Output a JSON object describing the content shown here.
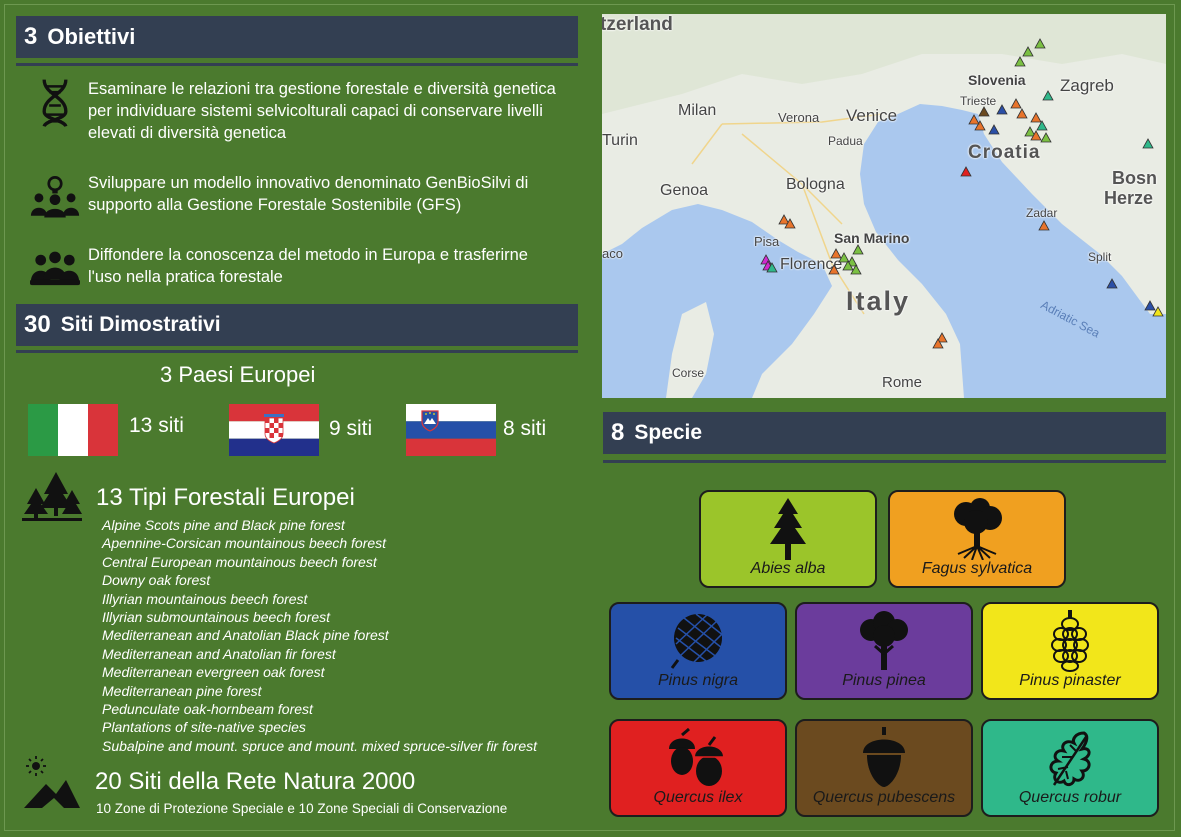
{
  "sections": {
    "objectives": {
      "number": "3",
      "title": "Obiettivi"
    },
    "sites": {
      "number": "30",
      "title": "Siti Dimostrativi"
    },
    "species": {
      "number": "8",
      "title": "Specie"
    }
  },
  "objectives": [
    {
      "icon": "dna-icon",
      "text": "Esaminare le relazioni tra gestione forestale e diversità genetica per individuare sistemi selvicolturali capaci di conservare livelli elevati di diversità genetica"
    },
    {
      "icon": "team-idea-icon",
      "text": "Sviluppare un modello innovativo denominato GenBioSilvi di supporto alla Gestione Forestale Sostenibile (GFS)"
    },
    {
      "icon": "people-group-icon",
      "text": "Diffondere la conoscenza del metodo in Europa e trasferirne l'uso nella pratica forestale"
    }
  ],
  "countries": {
    "title_number": "3",
    "title_text": "Paesi Europei",
    "list": [
      {
        "flag": "italy-flag",
        "label": "13 siti"
      },
      {
        "flag": "croatia-flag",
        "label": "9 siti"
      },
      {
        "flag": "slovenia-flag",
        "label": "8 siti"
      }
    ]
  },
  "forest_types": {
    "icon": "forest-icon",
    "title_number": "13",
    "title_text": "Tipi Forestali Europei",
    "items": [
      "Alpine Scots pine and Black pine forest",
      "Apennine-Corsican mountainous beech forest",
      "Central European mountainous beech forest",
      "Downy oak forest",
      "Illyrian mountainous beech forest",
      "Illyrian submountainous beech forest",
      "Mediterranean and Anatolian Black pine forest",
      "Mediterranean and Anatolian fir forest",
      "Mediterranean evergreen oak forest",
      "Mediterranean pine forest",
      "Pedunculate oak-hornbeam forest",
      "Plantations of site-native species",
      "Subalpine and mount. spruce and mount. mixed spruce-silver fir forest"
    ]
  },
  "natura": {
    "icon": "mountain-sun-icon",
    "title_number": "20",
    "title_text": "Siti della Rete Natura 2000",
    "subtitle": "10 Zone di Protezione Speciale e 10 Zone Speciali di Conservazione"
  },
  "map": {
    "labels": {
      "switzerland": "tzerland",
      "slovenia": "Slovenia",
      "zagreb": "Zagreb",
      "trieste": "Trieste",
      "milan": "Milan",
      "verona": "Verona",
      "venice": "Venice",
      "padua": "Padua",
      "turin": "Turin",
      "croatia": "Croatia",
      "genoa": "Genoa",
      "bologna": "Bologna",
      "bosnia": "Bosn",
      "herze": "Herze",
      "zadar": "Zadar",
      "pisa": "Pisa",
      "san_marino": "San Marino",
      "florence": "Florence",
      "aco": "aco",
      "split": "Split",
      "italy": "Italy",
      "adriatic": "Adriatic Sea",
      "corse": "Corse",
      "rome": "Rome"
    },
    "marker_colors": {
      "green": "#7bc043",
      "orange": "#e8742c",
      "blue": "#2b4fa6",
      "magenta": "#d02bd0",
      "teal": "#2fb88a",
      "red": "#e02020",
      "yellow": "#f2e61a",
      "brown": "#6b4a1f"
    }
  },
  "species": [
    {
      "name": "Abies alba",
      "icon": "fir-tree-icon",
      "color": "#9bc52a"
    },
    {
      "name": "Fagus sylvatica",
      "icon": "beech-tree-icon",
      "color": "#f0a020"
    },
    {
      "name": "Pinus nigra",
      "icon": "pine-cone-icon",
      "color": "#2550a8"
    },
    {
      "name": "Pinus pinea",
      "icon": "umbrella-pine-icon",
      "color": "#6b3c9c"
    },
    {
      "name": "Pinus pinaster",
      "icon": "maritime-pine-cone-icon",
      "color": "#f2e61a"
    },
    {
      "name": "Quercus ilex",
      "icon": "acorns-icon",
      "color": "#e02020"
    },
    {
      "name": "Quercus pubescens",
      "icon": "acorn-icon",
      "color": "#6b4a1f"
    },
    {
      "name": "Quercus robur",
      "icon": "oak-leaf-icon",
      "color": "#2fb88a"
    }
  ]
}
